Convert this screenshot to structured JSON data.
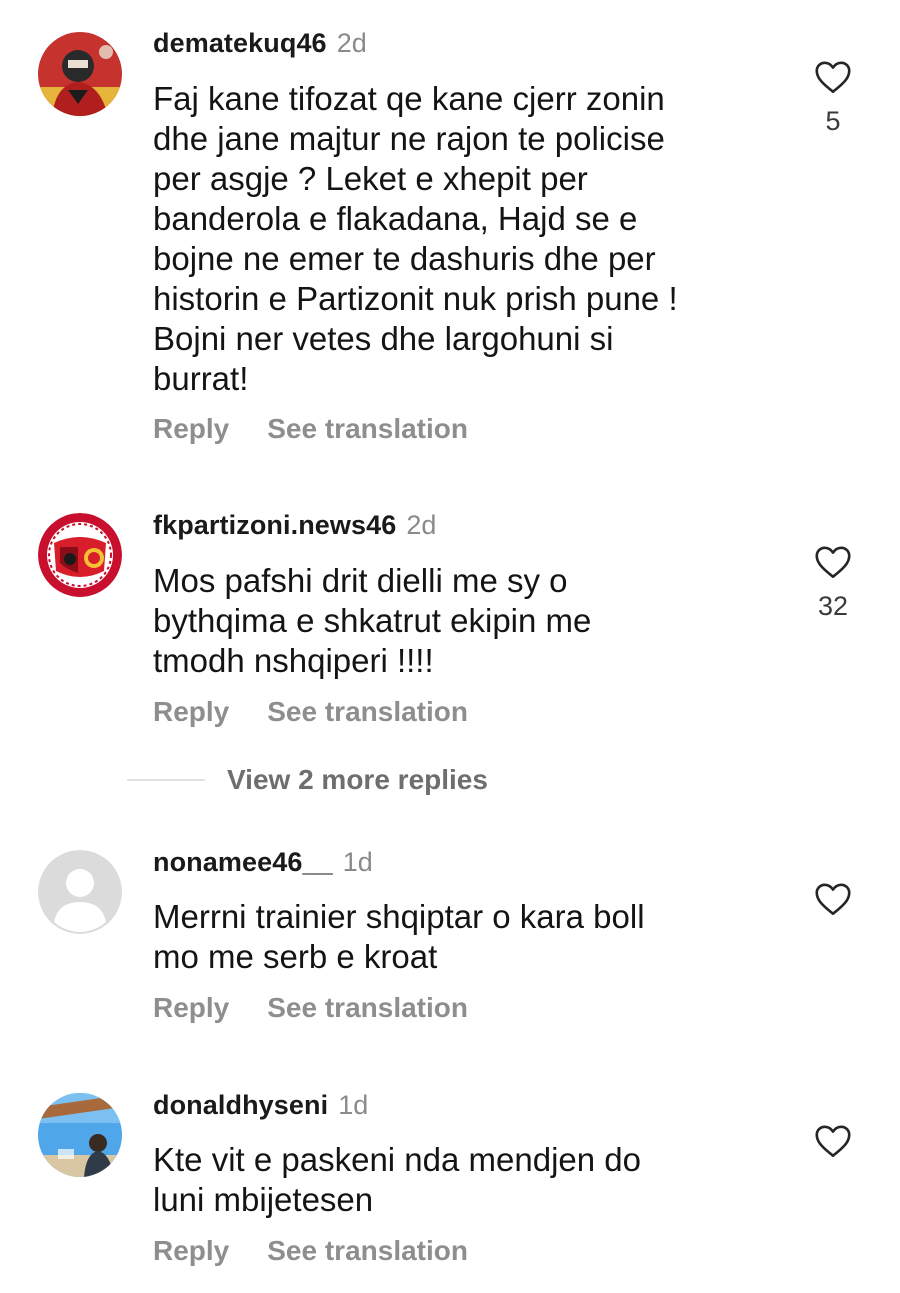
{
  "comments": [
    {
      "username": "dematekuq46",
      "time": "2d",
      "text": "Faj kane tifozat qe kane cjerr zonin\ndhe jane majtur ne rajon te policise\nper asgje ? Leket e xhepit per\nbanderola e flakadana, Hajd se e\nbojne ne emer te dashuris dhe per\nhistorin e Partizonit nuk prish pune !\nBojni ner vetes dhe largohuni si\nburrat!",
      "likes": "5",
      "reply_label": "Reply",
      "translate_label": "See translation"
    },
    {
      "username": "fkpartizoni.news46",
      "time": "2d",
      "text": "Mos pafshi drit dielli me sy o\nbythqima e shkatrut ekipin me\ntmodh nshqiperi !!!!",
      "likes": "32",
      "reply_label": "Reply",
      "translate_label": "See translation"
    },
    {
      "username": "nonamee46__",
      "time": "1d",
      "text": "Merrni trainier shqiptar o kara boll\nmo me serb e kroat",
      "likes": "",
      "reply_label": "Reply",
      "translate_label": "See translation"
    },
    {
      "username": "donaldhyseni",
      "time": "1d",
      "text": "Kte vit e paskeni nda mendjen do\nluni mbijetesen",
      "likes": "",
      "reply_label": "Reply",
      "translate_label": "See translation"
    }
  ],
  "view_more_replies": "View 2 more replies",
  "icons": {
    "like": "heart-outline-icon",
    "default_avatar": "person-silhouette-icon"
  },
  "colors": {
    "username": "#1a1a1a",
    "muted": "#8e8e8e",
    "text": "#141414",
    "accent_red": "#c8102e"
  }
}
